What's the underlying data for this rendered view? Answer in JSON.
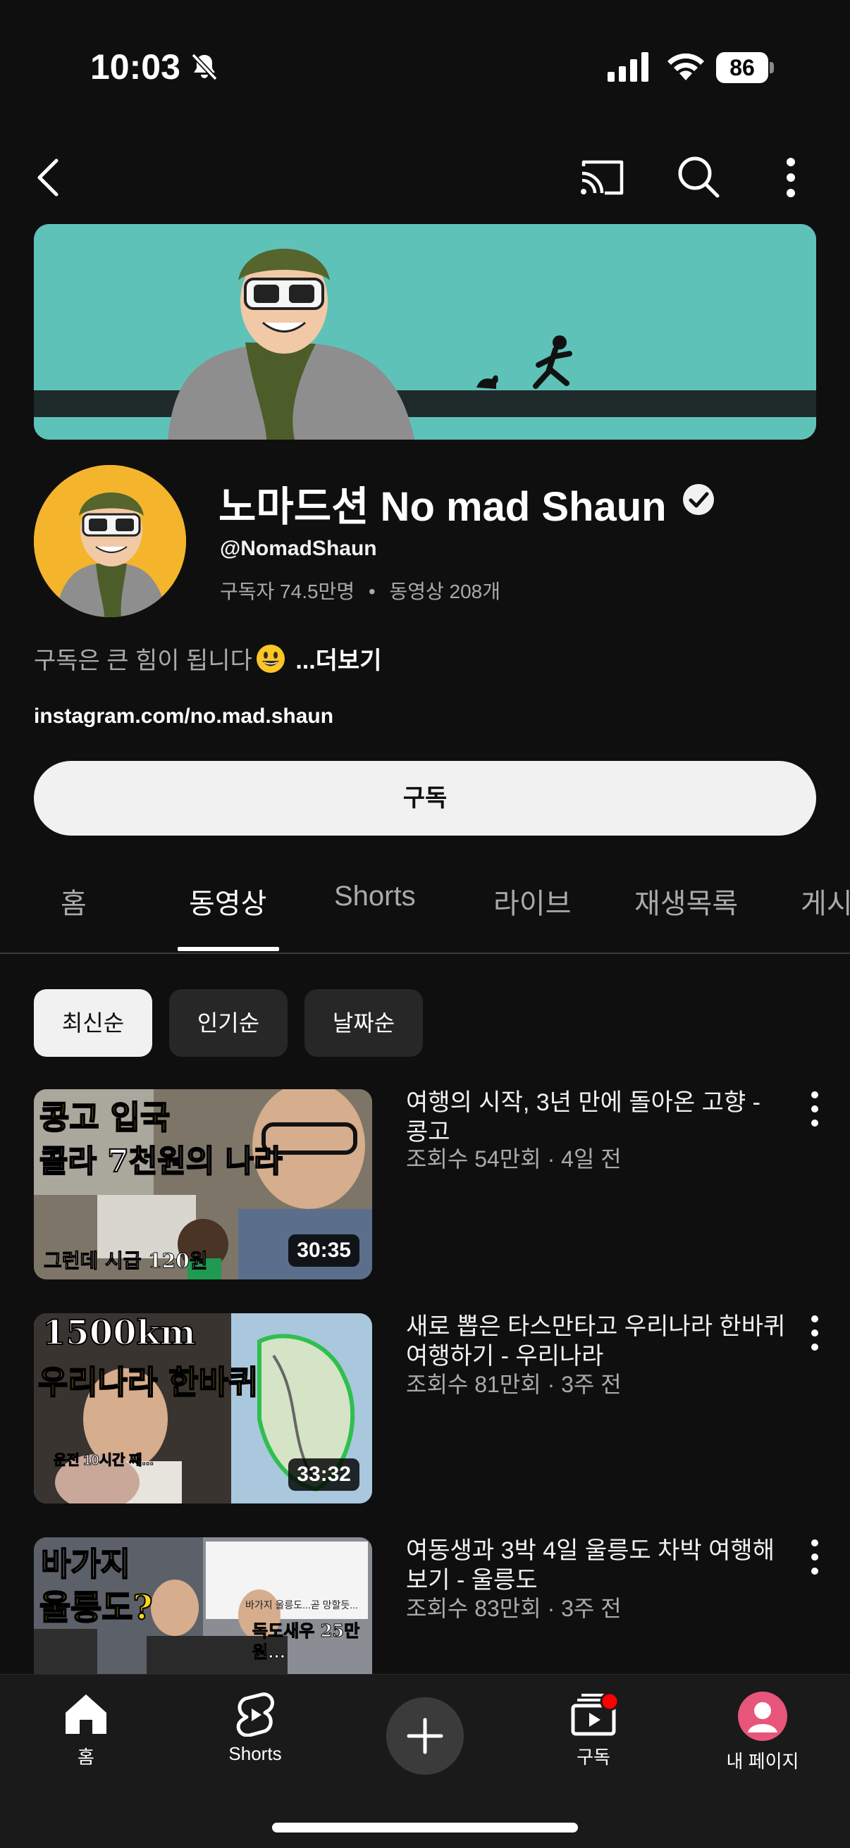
{
  "status_bar": {
    "time": "10:03",
    "battery": "86"
  },
  "channel": {
    "name": "노마드션 No mad Shaun",
    "handle": "@NomadShaun",
    "subscribers": "구독자 74.5만명",
    "video_count": "동영상 208개",
    "stats_separator": "•",
    "description": "구독은 큰 힘이 됩니다",
    "more_label": "...더보기",
    "link": "instagram.com/no.mad.shaun",
    "subscribe_label": "구독"
  },
  "tabs": [
    {
      "label": "홈"
    },
    {
      "label": "동영상"
    },
    {
      "label": "Shorts"
    },
    {
      "label": "라이브"
    },
    {
      "label": "재생목록"
    },
    {
      "label": "게시"
    }
  ],
  "chips": [
    {
      "label": "최신순"
    },
    {
      "label": "인기순"
    },
    {
      "label": "날짜순"
    }
  ],
  "videos": [
    {
      "title": "여행의 시작, 3년 만에 돌아온 고향 - 콩고",
      "meta": "조회수 54만회 · 4일 전",
      "duration": "30:35",
      "thumb_text_1": "콩고 입국",
      "thumb_text_2": "콜라 7천원의 나라",
      "thumb_text_3": "그런데 시급 120원"
    },
    {
      "title": "새로 뽑은 타스만타고 우리나라 한바퀴 여행하기 - 우리나라",
      "meta": "조회수 81만회 · 3주 전",
      "duration": "33:32",
      "thumb_text_1": "1500km",
      "thumb_text_2": "우리나라 한바퀴",
      "thumb_text_3": "운전 10시간 째..."
    },
    {
      "title": "여동생과 3박 4일 울릉도 차박 여행해보기 - 울릉도",
      "meta": "조회수 83만회 · 3주 전",
      "thumb_text_1": "바가지",
      "thumb_text_2": "울릉도?",
      "thumb_text_3": "독도새우 25만원...",
      "thumb_text_4": "바가지 울릉도...곧 망할듯..."
    }
  ],
  "bottom_nav": {
    "home": "홈",
    "shorts": "Shorts",
    "subscriptions": "구독",
    "me": "내 페이지"
  },
  "colors": {
    "background": "#0f0f0f",
    "banner": "#5ec2b9",
    "avatar_bg": "#f4b52c",
    "notification": "#ff0000",
    "profile_pink": "#e8557a"
  }
}
